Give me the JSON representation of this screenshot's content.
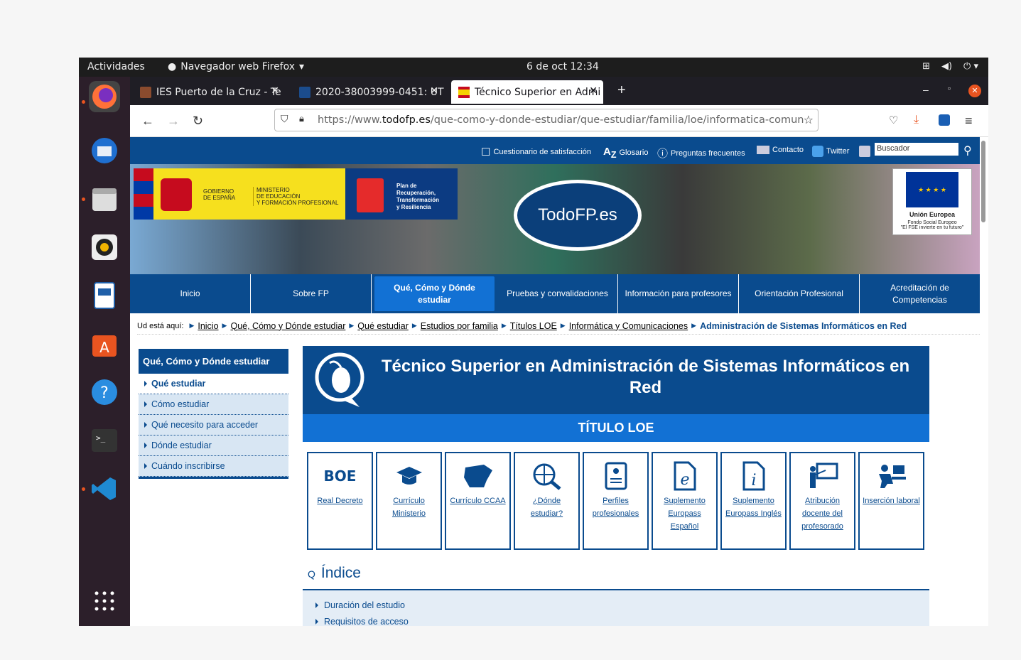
{
  "topbar": {
    "activities": "Actividades",
    "app": "Navegador web Firefox",
    "clock": "6 de oct  12:34"
  },
  "tabs": [
    {
      "label": "IES Puerto de la Cruz - Te"
    },
    {
      "label": "2020-38003999-0451: UT"
    },
    {
      "label": "Técnico Superior en Admi"
    }
  ],
  "url": {
    "prefix": "https://www.",
    "host": "todofp.es",
    "path": "/que-como-y-donde-estudiar/que-estudiar/familia/loe/informatica-comun"
  },
  "util": {
    "survey": "Cuestionario de satisfacción",
    "glossary": "Glosario",
    "faq": "Preguntas frecuentes",
    "contact": "Contacto",
    "twitter": "Twitter",
    "search_placeholder": "Buscador"
  },
  "banner": {
    "gob1": "GOBIERNO",
    "gob2": "DE ESPAÑA",
    "min1": "MINISTERIO",
    "min2": "DE EDUCACIÓN",
    "min3": "Y FORMACIÓN PROFESIONAL",
    "plan1": "Plan de",
    "plan2": "Recuperación,",
    "plan3": "Transformación",
    "plan4": "y Resiliencia",
    "logo": "TodoFP.es",
    "eu1": "Unión Europea",
    "eu2": "Fondo Social Europeo",
    "eu3": "\"El FSE invierte en tu futuro\""
  },
  "menu": [
    "Inicio",
    "Sobre FP",
    "Qué, Cómo y Dónde estudiar",
    "Pruebas y convalidaciones",
    "Información para profesores",
    "Orientación Profesional",
    "Acreditación de Competencias"
  ],
  "crumbs": {
    "label": "Ud está aquí:",
    "items": [
      "Inicio",
      "Qué, Cómo y Dónde estudiar",
      "Qué estudiar",
      "Estudios por familia",
      "Títulos LOE",
      "Informática y Comunicaciones"
    ],
    "current": "Administración de Sistemas Informáticos en Red"
  },
  "side": {
    "title": "Qué, Cómo y Dónde estudiar",
    "items": [
      "Qué estudiar",
      "Cómo estudiar",
      "Qué necesito para acceder",
      "Dónde estudiar",
      "Cuándo inscribirse"
    ]
  },
  "main": {
    "title": "Técnico Superior en Administración de Sistemas Informáticos en Red",
    "subtitle": "TÍTULO LOE"
  },
  "cards": [
    "Real Decreto",
    "Currículo Ministerio",
    "Currículo CCAA",
    "¿Dónde estudiar?",
    "Perfiles profesionales",
    "Suplemento Europass Español",
    "Suplemento Europass Inglés",
    "Atribución docente del profesorado",
    "Inserción laboral"
  ],
  "indice": {
    "title": "Índice",
    "items": [
      "Duración del estudio",
      "Requisitos de acceso"
    ]
  }
}
